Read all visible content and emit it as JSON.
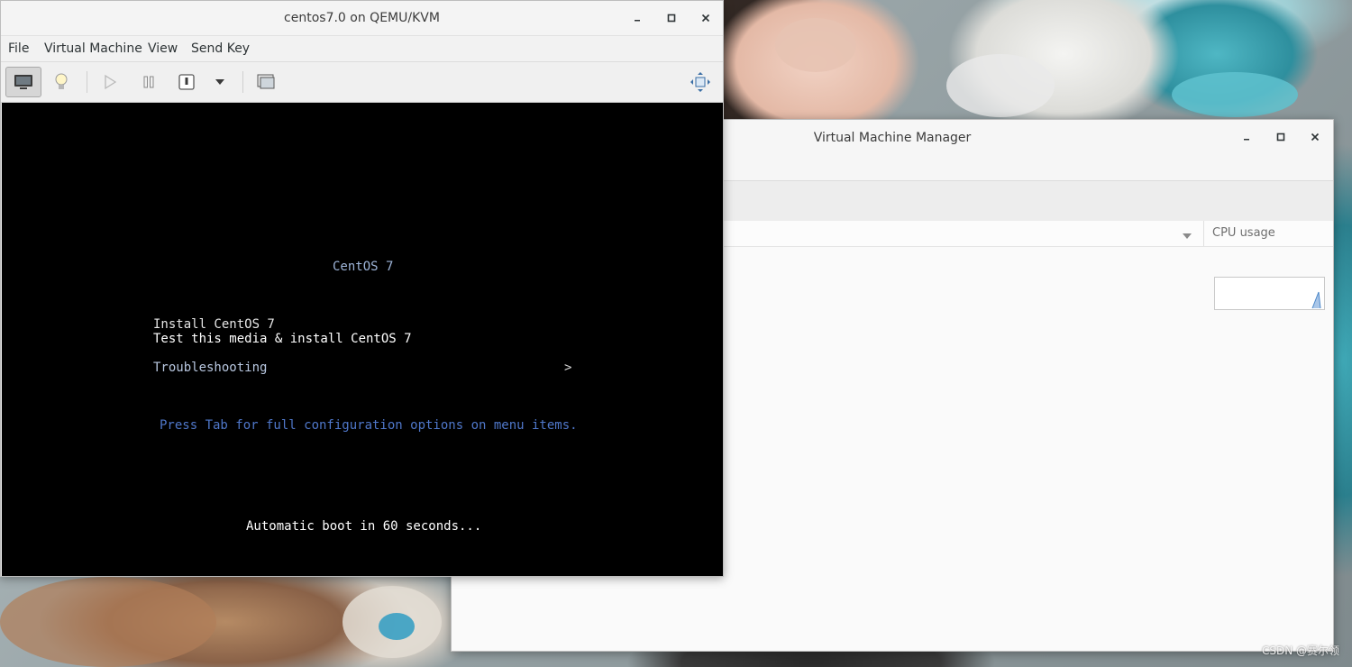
{
  "vmm_window": {
    "title": "Virtual Machine Manager",
    "column_header": {
      "cpu_usage": "CPU usage"
    }
  },
  "console_window": {
    "title": "centos7.0 on QEMU/KVM",
    "menu": [
      "File",
      "Virtual Machine",
      "View",
      "Send Key"
    ],
    "toolbar": {
      "icons": [
        "console-icon",
        "details-lightbulb-icon",
        "run-icon",
        "pause-icon",
        "shutdown-icon",
        "shutdown-menu-icon",
        "snapshots-icon",
        "fullscreen-icon"
      ]
    }
  },
  "boot_screen": {
    "title": "CentOS 7",
    "options": [
      "Install CentOS 7",
      "Test this media & install CentOS 7",
      "Troubleshooting"
    ],
    "submenu_arrow": ">",
    "hint": "Press Tab for full configuration options on menu items.",
    "autoboot": "Automatic boot in 60 seconds..."
  },
  "watermark": "CSDN @赛尔领",
  "colors": {
    "terminal_bg": "#000000",
    "title_blue": "#9db4d8",
    "hint_blue": "#4f77c9"
  }
}
